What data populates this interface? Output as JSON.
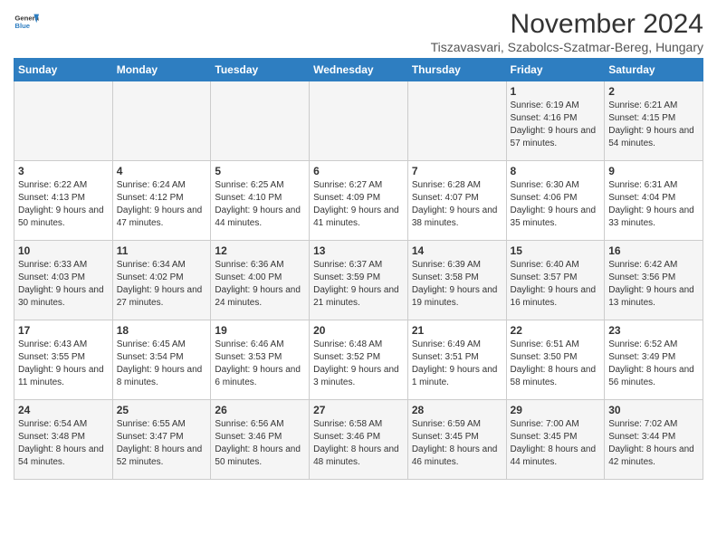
{
  "header": {
    "logo_line1": "General",
    "logo_line2": "Blue",
    "month": "November 2024",
    "location": "Tiszavasvari, Szabolcs-Szatmar-Bereg, Hungary"
  },
  "days_of_week": [
    "Sunday",
    "Monday",
    "Tuesday",
    "Wednesday",
    "Thursday",
    "Friday",
    "Saturday"
  ],
  "weeks": [
    [
      {
        "day": "",
        "info": ""
      },
      {
        "day": "",
        "info": ""
      },
      {
        "day": "",
        "info": ""
      },
      {
        "day": "",
        "info": ""
      },
      {
        "day": "",
        "info": ""
      },
      {
        "day": "1",
        "info": "Sunrise: 6:19 AM\nSunset: 4:16 PM\nDaylight: 9 hours and 57 minutes."
      },
      {
        "day": "2",
        "info": "Sunrise: 6:21 AM\nSunset: 4:15 PM\nDaylight: 9 hours and 54 minutes."
      }
    ],
    [
      {
        "day": "3",
        "info": "Sunrise: 6:22 AM\nSunset: 4:13 PM\nDaylight: 9 hours and 50 minutes."
      },
      {
        "day": "4",
        "info": "Sunrise: 6:24 AM\nSunset: 4:12 PM\nDaylight: 9 hours and 47 minutes."
      },
      {
        "day": "5",
        "info": "Sunrise: 6:25 AM\nSunset: 4:10 PM\nDaylight: 9 hours and 44 minutes."
      },
      {
        "day": "6",
        "info": "Sunrise: 6:27 AM\nSunset: 4:09 PM\nDaylight: 9 hours and 41 minutes."
      },
      {
        "day": "7",
        "info": "Sunrise: 6:28 AM\nSunset: 4:07 PM\nDaylight: 9 hours and 38 minutes."
      },
      {
        "day": "8",
        "info": "Sunrise: 6:30 AM\nSunset: 4:06 PM\nDaylight: 9 hours and 35 minutes."
      },
      {
        "day": "9",
        "info": "Sunrise: 6:31 AM\nSunset: 4:04 PM\nDaylight: 9 hours and 33 minutes."
      }
    ],
    [
      {
        "day": "10",
        "info": "Sunrise: 6:33 AM\nSunset: 4:03 PM\nDaylight: 9 hours and 30 minutes."
      },
      {
        "day": "11",
        "info": "Sunrise: 6:34 AM\nSunset: 4:02 PM\nDaylight: 9 hours and 27 minutes."
      },
      {
        "day": "12",
        "info": "Sunrise: 6:36 AM\nSunset: 4:00 PM\nDaylight: 9 hours and 24 minutes."
      },
      {
        "day": "13",
        "info": "Sunrise: 6:37 AM\nSunset: 3:59 PM\nDaylight: 9 hours and 21 minutes."
      },
      {
        "day": "14",
        "info": "Sunrise: 6:39 AM\nSunset: 3:58 PM\nDaylight: 9 hours and 19 minutes."
      },
      {
        "day": "15",
        "info": "Sunrise: 6:40 AM\nSunset: 3:57 PM\nDaylight: 9 hours and 16 minutes."
      },
      {
        "day": "16",
        "info": "Sunrise: 6:42 AM\nSunset: 3:56 PM\nDaylight: 9 hours and 13 minutes."
      }
    ],
    [
      {
        "day": "17",
        "info": "Sunrise: 6:43 AM\nSunset: 3:55 PM\nDaylight: 9 hours and 11 minutes."
      },
      {
        "day": "18",
        "info": "Sunrise: 6:45 AM\nSunset: 3:54 PM\nDaylight: 9 hours and 8 minutes."
      },
      {
        "day": "19",
        "info": "Sunrise: 6:46 AM\nSunset: 3:53 PM\nDaylight: 9 hours and 6 minutes."
      },
      {
        "day": "20",
        "info": "Sunrise: 6:48 AM\nSunset: 3:52 PM\nDaylight: 9 hours and 3 minutes."
      },
      {
        "day": "21",
        "info": "Sunrise: 6:49 AM\nSunset: 3:51 PM\nDaylight: 9 hours and 1 minute."
      },
      {
        "day": "22",
        "info": "Sunrise: 6:51 AM\nSunset: 3:50 PM\nDaylight: 8 hours and 58 minutes."
      },
      {
        "day": "23",
        "info": "Sunrise: 6:52 AM\nSunset: 3:49 PM\nDaylight: 8 hours and 56 minutes."
      }
    ],
    [
      {
        "day": "24",
        "info": "Sunrise: 6:54 AM\nSunset: 3:48 PM\nDaylight: 8 hours and 54 minutes."
      },
      {
        "day": "25",
        "info": "Sunrise: 6:55 AM\nSunset: 3:47 PM\nDaylight: 8 hours and 52 minutes."
      },
      {
        "day": "26",
        "info": "Sunrise: 6:56 AM\nSunset: 3:46 PM\nDaylight: 8 hours and 50 minutes."
      },
      {
        "day": "27",
        "info": "Sunrise: 6:58 AM\nSunset: 3:46 PM\nDaylight: 8 hours and 48 minutes."
      },
      {
        "day": "28",
        "info": "Sunrise: 6:59 AM\nSunset: 3:45 PM\nDaylight: 8 hours and 46 minutes."
      },
      {
        "day": "29",
        "info": "Sunrise: 7:00 AM\nSunset: 3:45 PM\nDaylight: 8 hours and 44 minutes."
      },
      {
        "day": "30",
        "info": "Sunrise: 7:02 AM\nSunset: 3:44 PM\nDaylight: 8 hours and 42 minutes."
      }
    ]
  ]
}
